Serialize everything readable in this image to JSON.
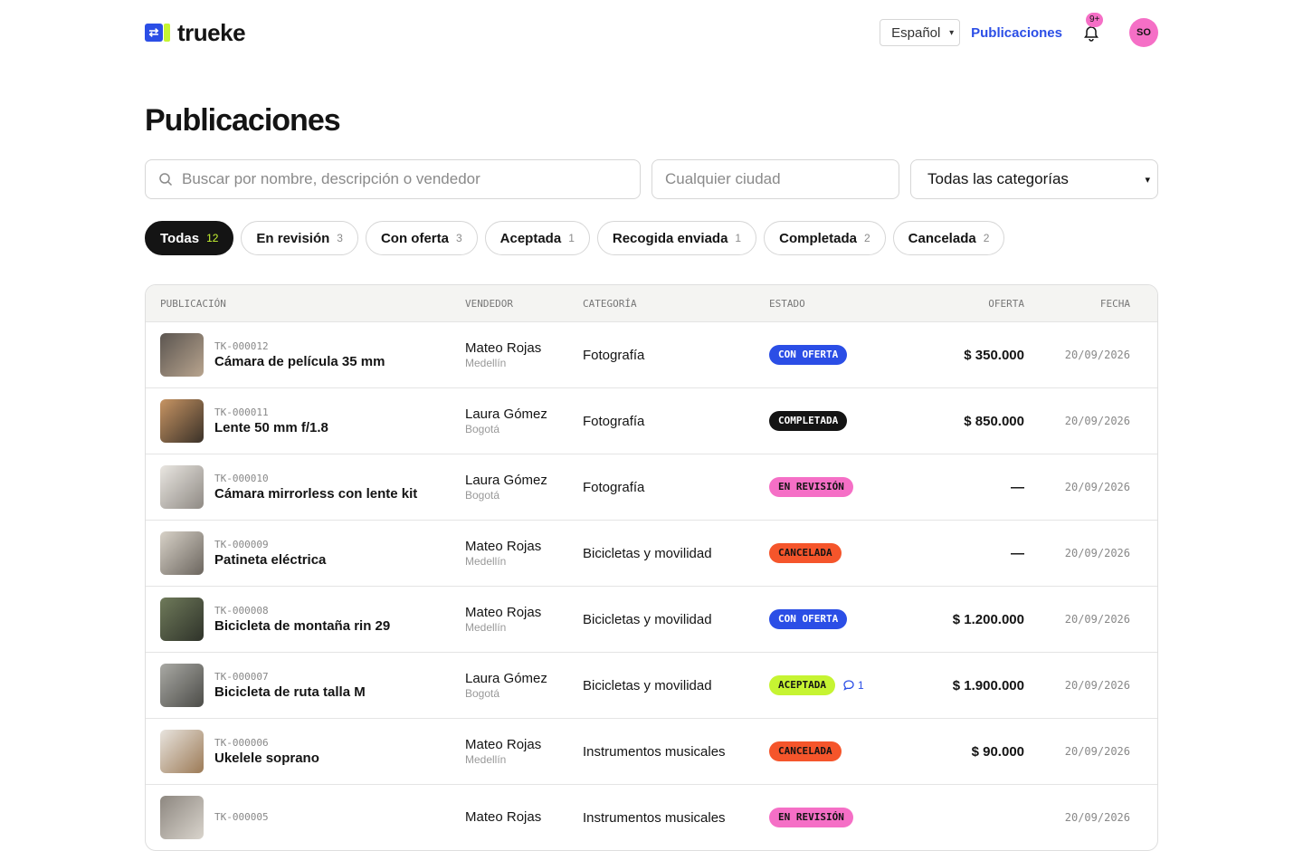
{
  "brand": {
    "name": "trueke",
    "mark_glyph": "⇄",
    "colors": {
      "blue": "#2b4ee6",
      "lime": "#c6f432",
      "pink": "#f56fc6"
    }
  },
  "header": {
    "language": "Español",
    "nav_link": "Publicaciones",
    "notifications_badge": "9+",
    "avatar_initials": "SO"
  },
  "page_title": "Publicaciones",
  "filters": {
    "search_placeholder": "Buscar por nombre, descripción o vendedor",
    "city_placeholder": "Cualquier ciudad",
    "category_selected": "Todas las categorías"
  },
  "status_tabs": [
    {
      "label": "Todas",
      "count": "12",
      "active": true
    },
    {
      "label": "En revisión",
      "count": "3"
    },
    {
      "label": "Con oferta",
      "count": "3"
    },
    {
      "label": "Aceptada",
      "count": "1"
    },
    {
      "label": "Recogida enviada",
      "count": "1"
    },
    {
      "label": "Completada",
      "count": "2"
    },
    {
      "label": "Cancelada",
      "count": "2"
    }
  ],
  "table": {
    "columns": [
      "PUBLICACIÓN",
      "VENDEDOR",
      "CATEGORÍA",
      "ESTADO",
      "OFERTA",
      "FECHA"
    ],
    "rows": [
      {
        "code": "TK-000012",
        "title": "Cámara de película 35 mm",
        "seller": "Mateo Rojas",
        "city": "Medellín",
        "category": "Fotografía",
        "status": "CON OFERTA",
        "status_bg": "#2b4ee6",
        "status_fg": "#ffffff",
        "offer": "$ 350.000",
        "date": "20/09/2026",
        "thumb": [
          "#5b5550",
          "#b8a48e"
        ]
      },
      {
        "code": "TK-000011",
        "title": "Lente 50 mm f/1.8",
        "seller": "Laura Gómez",
        "city": "Bogotá",
        "category": "Fotografía",
        "status": "COMPLETADA",
        "status_bg": "#141414",
        "status_fg": "#ffffff",
        "offer": "$ 850.000",
        "date": "20/09/2026",
        "thumb": [
          "#c79463",
          "#3a3128"
        ]
      },
      {
        "code": "TK-000010",
        "title": "Cámara mirrorless con lente kit",
        "seller": "Laura Gómez",
        "city": "Bogotá",
        "category": "Fotografía",
        "status": "EN REVISIÓN",
        "status_bg": "#f56fc6",
        "status_fg": "#141414",
        "offer": "—",
        "date": "20/09/2026",
        "thumb": [
          "#e9e6e1",
          "#8f8a84"
        ]
      },
      {
        "code": "TK-000009",
        "title": "Patineta eléctrica",
        "seller": "Mateo Rojas",
        "city": "Medellín",
        "category": "Bicicletas y movilidad",
        "status": "CANCELADA",
        "status_bg": "#f5552b",
        "status_fg": "#141414",
        "offer": "—",
        "date": "20/09/2026",
        "thumb": [
          "#d8d2c8",
          "#6b655e"
        ]
      },
      {
        "code": "TK-000008",
        "title": "Bicicleta de montaña rin 29",
        "seller": "Mateo Rojas",
        "city": "Medellín",
        "category": "Bicicletas y movilidad",
        "status": "CON OFERTA",
        "status_bg": "#2b4ee6",
        "status_fg": "#ffffff",
        "offer": "$ 1.200.000",
        "date": "20/09/2026",
        "thumb": [
          "#6f7a5a",
          "#2f332a"
        ]
      },
      {
        "code": "TK-000007",
        "title": "Bicicleta de ruta talla M",
        "seller": "Laura Gómez",
        "city": "Bogotá",
        "category": "Bicicletas y movilidad",
        "status": "ACEPTADA",
        "status_bg": "#c6f432",
        "status_fg": "#141414",
        "offer": "$ 1.900.000",
        "date": "20/09/2026",
        "messages": "1",
        "thumb": [
          "#a9a9a4",
          "#4c4c48"
        ]
      },
      {
        "code": "TK-000006",
        "title": "Ukelele soprano",
        "seller": "Mateo Rojas",
        "city": "Medellín",
        "category": "Instrumentos musicales",
        "status": "CANCELADA",
        "status_bg": "#f5552b",
        "status_fg": "#141414",
        "offer": "$ 90.000",
        "date": "20/09/2026",
        "thumb": [
          "#e8e4de",
          "#9c7a56"
        ]
      },
      {
        "code": "TK-000005",
        "title": "",
        "seller": "Mateo Rojas",
        "city": "",
        "category": "Instrumentos musicales",
        "status": "EN REVISIÓN",
        "status_bg": "#f56fc6",
        "status_fg": "#141414",
        "offer": "",
        "date": "20/09/2026",
        "thumb": [
          "#8d8780",
          "#d9d4cc"
        ]
      }
    ]
  }
}
